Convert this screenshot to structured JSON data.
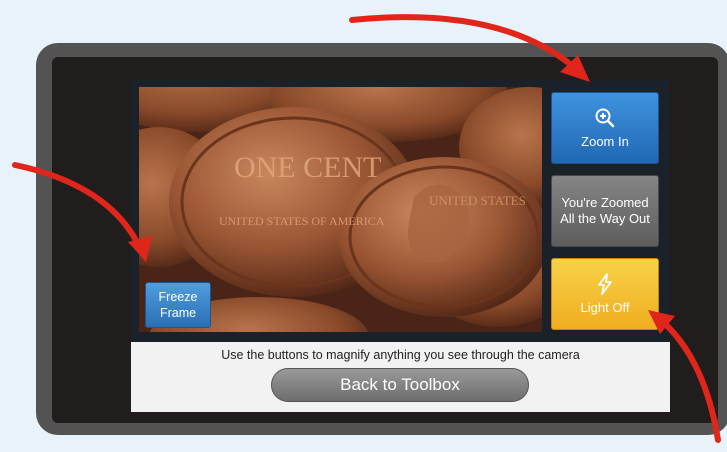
{
  "camera": {
    "coin_text_left": "ONE CENT",
    "coin_text_small": "UNITED STATES OF AMERICA",
    "coin_text_right": "UNITED STATES"
  },
  "buttons": {
    "freeze_frame": "Freeze Frame",
    "zoom_in": "Zoom In",
    "zoom_status": "You're Zoomed All the Way Out",
    "light": "Light Off"
  },
  "footer": {
    "hint": "Use the buttons to magnify anything you see through the camera",
    "back": "Back to Toolbox"
  },
  "colors": {
    "page_background": "#e8f2fb",
    "arrow": "#e0251b",
    "zoom_in_button": "#2f7fcf",
    "zoom_status_button": "#707070",
    "light_button": "#f4c030",
    "freeze_button": "#3a86cc"
  },
  "icons": {
    "zoom_in": "magnifier-plus-icon",
    "light": "lightning-bolt-icon"
  }
}
